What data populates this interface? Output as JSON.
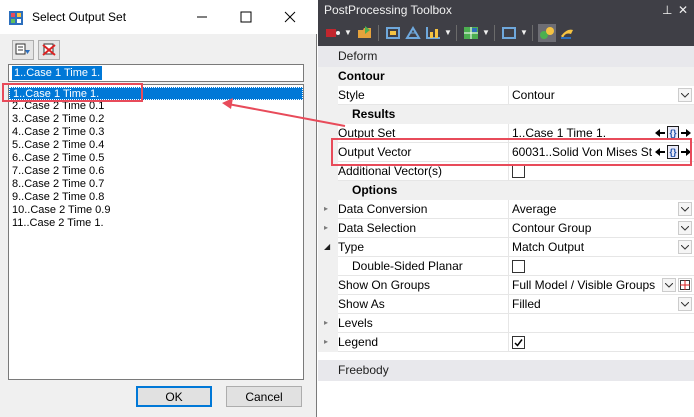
{
  "dialog": {
    "title": "Select Output Set",
    "current_value": "1..Case 1 Time 1.",
    "items": [
      "1..Case 1 Time 1.",
      "2..Case 2 Time 0.1",
      "3..Case 2 Time 0.2",
      "4..Case 2 Time 0.3",
      "5..Case 2 Time 0.4",
      "6..Case 2 Time 0.5",
      "7..Case 2 Time 0.6",
      "8..Case 2 Time 0.7",
      "9..Case 2 Time 0.8",
      "10..Case 2 Time 0.9",
      "11..Case 2 Time 1."
    ],
    "ok_label": "OK",
    "cancel_label": "Cancel"
  },
  "toolbox": {
    "title": "PostProcessing Toolbox",
    "deform_label": "Deform",
    "contour_category": "Contour",
    "style_label": "Style",
    "style_value": "Contour",
    "results_category": "Results",
    "output_set_label": "Output Set",
    "output_set_value": "1..Case 1 Time 1.",
    "output_vector_label": "Output Vector",
    "output_vector_value": "60031..Solid Von Mises St",
    "additional_vectors_label": "Additional Vector(s)",
    "options_category": "Options",
    "data_conversion_label": "Data Conversion",
    "data_conversion_value": "Average",
    "data_selection_label": "Data Selection",
    "data_selection_value": "Contour Group",
    "type_label": "Type",
    "type_value": "Match Output",
    "double_sided_label": "Double-Sided Planar",
    "show_on_groups_label": "Show On Groups",
    "show_on_groups_value": "Full Model / Visible Groups",
    "show_as_label": "Show As",
    "show_as_value": "Filled",
    "levels_label": "Levels",
    "legend_label": "Legend",
    "freebody_label": "Freebody",
    "pin_glyph": "⊥",
    "close_glyph": "✕"
  },
  "colors": {
    "selection": "#0078d7",
    "highlight": "#e84b5a",
    "toolbox_dark": "#2d2d30"
  }
}
